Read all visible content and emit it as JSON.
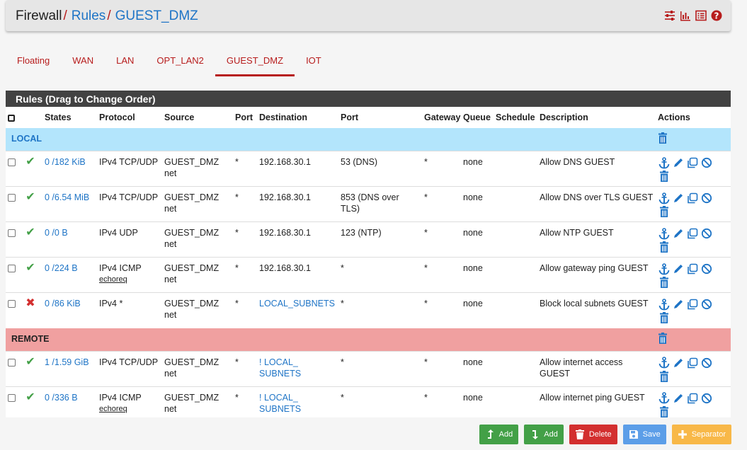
{
  "breadcrumb": {
    "root": "Firewall",
    "section": "Rules",
    "current": "GUEST_DMZ",
    "sep": "/"
  },
  "header_icons": [
    "sliders-icon",
    "bar-chart-icon",
    "list-icon",
    "help-icon"
  ],
  "tabs": [
    {
      "label": "Floating",
      "active": false
    },
    {
      "label": "WAN",
      "active": false
    },
    {
      "label": "LAN",
      "active": false
    },
    {
      "label": "OPT_LAN2",
      "active": false
    },
    {
      "label": "GUEST_DMZ",
      "active": true
    },
    {
      "label": "IOT",
      "active": false
    }
  ],
  "panel_title": "Rules (Drag to Change Order)",
  "columns": [
    "States",
    "Protocol",
    "Source",
    "Port",
    "Destination",
    "Port",
    "Gateway",
    "Queue",
    "Schedule",
    "Description",
    "Actions"
  ],
  "separators": {
    "local": "LOCAL",
    "remote": "REMOTE"
  },
  "rules_local": [
    {
      "status": "pass",
      "states": "0 /182 KiB",
      "protocol": "IPv4 TCP/UDP",
      "protocol_sub": "",
      "source": "GUEST_DMZ net",
      "sport": "*",
      "destination": "192.168.30.1",
      "dest_link": false,
      "dport": "53 (DNS)",
      "gateway": "*",
      "queue": "none",
      "schedule": "",
      "description": "Allow DNS GUEST"
    },
    {
      "status": "pass",
      "states": "0 /6.54 MiB",
      "protocol": "IPv4 TCP/UDP",
      "protocol_sub": "",
      "source": "GUEST_DMZ net",
      "sport": "*",
      "destination": "192.168.30.1",
      "dest_link": false,
      "dport": "853 (DNS over TLS)",
      "gateway": "*",
      "queue": "none",
      "schedule": "",
      "description": "Allow DNS over TLS GUEST"
    },
    {
      "status": "pass",
      "states": "0 /0 B",
      "protocol": "IPv4 UDP",
      "protocol_sub": "",
      "source": "GUEST_DMZ net",
      "sport": "*",
      "destination": "192.168.30.1",
      "dest_link": false,
      "dport": "123 (NTP)",
      "gateway": "*",
      "queue": "none",
      "schedule": "",
      "description": "Allow NTP GUEST"
    },
    {
      "status": "pass",
      "states": "0 /224 B",
      "protocol": "IPv4 ICMP",
      "protocol_sub": "echoreq",
      "source": "GUEST_DMZ net",
      "sport": "*",
      "destination": "192.168.30.1",
      "dest_link": false,
      "dport": "*",
      "gateway": "*",
      "queue": "none",
      "schedule": "",
      "description": "Allow gateway ping GUEST"
    },
    {
      "status": "block",
      "states": "0 /86 KiB",
      "protocol": "IPv4 *",
      "protocol_sub": "",
      "source": "GUEST_DMZ net",
      "sport": "*",
      "destination": "LOCAL_SUBNETS",
      "dest_link": true,
      "dport": "*",
      "gateway": "*",
      "queue": "none",
      "schedule": "",
      "description": "Block local subnets GUEST"
    }
  ],
  "rules_remote": [
    {
      "status": "pass",
      "states": "1 /1.59 GiB",
      "protocol": "IPv4 TCP/UDP",
      "protocol_sub": "",
      "source": "GUEST_DMZ net",
      "sport": "*",
      "destination": "! LOCAL_ SUBNETS",
      "dest_link": true,
      "dport": "*",
      "gateway": "*",
      "queue": "none",
      "schedule": "",
      "description": "Allow internet access GUEST"
    },
    {
      "status": "pass",
      "states": "0 /336 B",
      "protocol": "IPv4 ICMP",
      "protocol_sub": "echoreq",
      "source": "GUEST_DMZ net",
      "sport": "*",
      "destination": "! LOCAL_ SUBNETS",
      "dest_link": true,
      "dport": "*",
      "gateway": "*",
      "queue": "none",
      "schedule": "",
      "description": "Allow internet ping GUEST"
    }
  ],
  "buttons": {
    "add_top": "Add",
    "add_bottom": "Add",
    "delete": "Delete",
    "save": "Save",
    "separator": "Separator"
  },
  "colors": {
    "accent": "#b71c1c",
    "link": "#1e74c6",
    "local_sep": "#b3e5fc",
    "remote_sep": "#f0a0a0",
    "pass": "#43a047",
    "block": "#d32f2f"
  }
}
